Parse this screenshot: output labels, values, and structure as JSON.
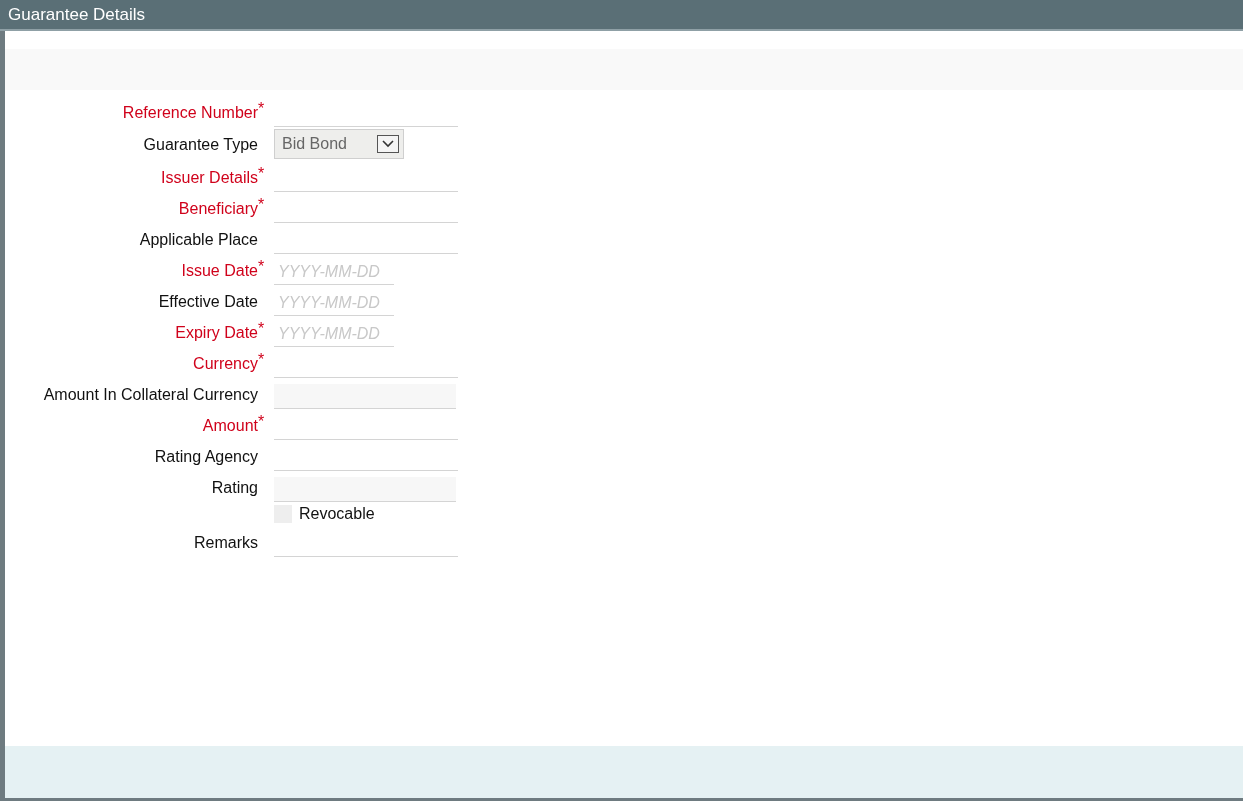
{
  "window": {
    "title": "Guarantee Details"
  },
  "required_marker": "*",
  "fields": [
    {
      "kind": "text",
      "label": "Reference Number",
      "required": true
    },
    {
      "kind": "select",
      "label": "Guarantee Type",
      "required": false,
      "value": "Bid Bond"
    },
    {
      "kind": "text",
      "label": "Issuer Details",
      "required": true
    },
    {
      "kind": "text",
      "label": "Beneficiary",
      "required": true
    },
    {
      "kind": "text",
      "label": "Applicable Place",
      "required": false
    },
    {
      "kind": "date",
      "label": "Issue Date",
      "required": true,
      "placeholder": "YYYY-MM-DD"
    },
    {
      "kind": "date",
      "label": "Effective Date",
      "required": false,
      "placeholder": "YYYY-MM-DD"
    },
    {
      "kind": "date",
      "label": "Expiry Date",
      "required": true,
      "placeholder": "YYYY-MM-DD"
    },
    {
      "kind": "text",
      "label": "Currency",
      "required": true
    },
    {
      "kind": "readonly",
      "label": "Amount In Collateral Currency",
      "required": false
    },
    {
      "kind": "text",
      "label": "Amount",
      "required": true
    },
    {
      "kind": "text",
      "label": "Rating Agency",
      "required": false
    },
    {
      "kind": "readonly",
      "label": "Rating",
      "required": false
    },
    {
      "kind": "checkbox",
      "label": "Revocable",
      "required": false,
      "checked": false
    },
    {
      "kind": "text",
      "label": "Remarks",
      "required": false
    }
  ]
}
